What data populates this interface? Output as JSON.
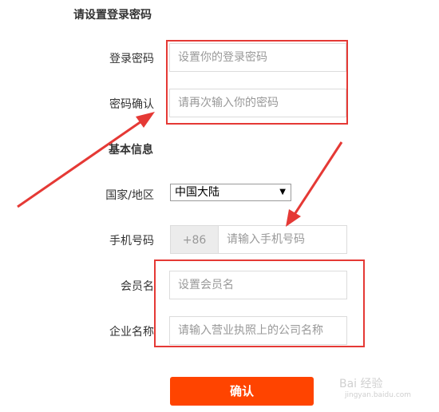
{
  "form": {
    "password_section_title": "请设置登录密码",
    "login_password_label": "登录密码",
    "login_password_placeholder": "设置你的登录密码",
    "confirm_password_label": "密码确认",
    "confirm_password_placeholder": "请再次输入你的密码",
    "basic_info_title": "基本信息",
    "country_label": "国家/地区",
    "country_value": "中国大陆",
    "phone_label": "手机号码",
    "phone_prefix": "+86",
    "phone_placeholder": "请输入手机号码",
    "member_label": "会员名",
    "member_placeholder": "设置会员名",
    "company_label": "企业名称",
    "company_placeholder": "请输入营业执照上的公司名称",
    "submit_label": "确认"
  },
  "watermark": {
    "text": "Bai 经验",
    "sub": "jingyan.baidu.com"
  },
  "colors": {
    "accent": "#ff4400",
    "annotation": "#e53935"
  },
  "icons": {
    "select_arrow": "chevron-down-icon"
  }
}
